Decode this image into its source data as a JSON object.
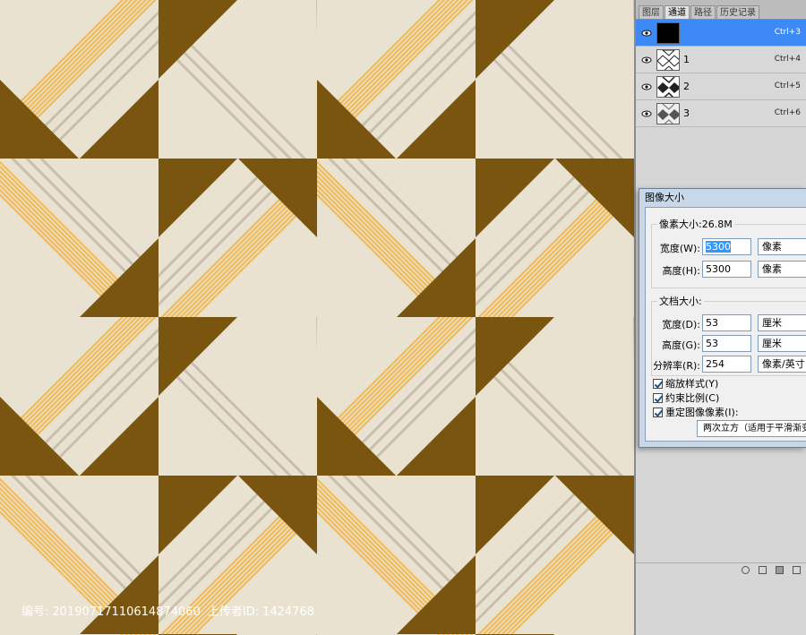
{
  "caption": {
    "id_label": "编号:",
    "id_value": "20190717110614874060",
    "uploader_label": "上传者ID:",
    "uploader_value": "1424768"
  },
  "colors": {
    "cream": "#e9e2d1",
    "brown": "#7a5510",
    "gold": "#f1bb58",
    "grey_line": "#c8bfae",
    "selection_blue": "#3d8af7"
  },
  "panel": {
    "tabs": [
      "图层",
      "通道",
      "路径",
      "历史记录"
    ],
    "active_tab": 1,
    "channels": [
      {
        "name": "",
        "shortcut": "Ctrl+3",
        "selected": true,
        "thumb": "black-thumb-icon"
      },
      {
        "name": "1",
        "shortcut": "Ctrl+4",
        "selected": false,
        "thumb": "pattern-thumb-icon"
      },
      {
        "name": "2",
        "shortcut": "Ctrl+5",
        "selected": false,
        "thumb": "pattern-thumb-icon"
      },
      {
        "name": "3",
        "shortcut": "Ctrl+6",
        "selected": false,
        "thumb": "pattern-thumb-icon"
      }
    ]
  },
  "dialog": {
    "title": "图像大小",
    "pixel_dimensions_label": "像素大小:26.8M",
    "width_label": "宽度(W):",
    "width_value": "5300",
    "width_unit": "像素",
    "height_label": "高度(H):",
    "height_value": "5300",
    "height_unit": "像素",
    "document_size_label": "文档大小:",
    "doc_width_label": "宽度(D):",
    "doc_width_value": "53",
    "doc_width_unit": "厘米",
    "doc_height_label": "高度(G):",
    "doc_height_value": "53",
    "doc_height_unit": "厘米",
    "resolution_label": "分辨率(R):",
    "resolution_value": "254",
    "resolution_unit": "像素/英寸",
    "scale_styles_label": "缩放样式(Y)",
    "constrain_label": "约束比例(C)",
    "resample_label": "重定图像像素(I):",
    "resample_method": "两次立方（适用于平滑渐变"
  }
}
